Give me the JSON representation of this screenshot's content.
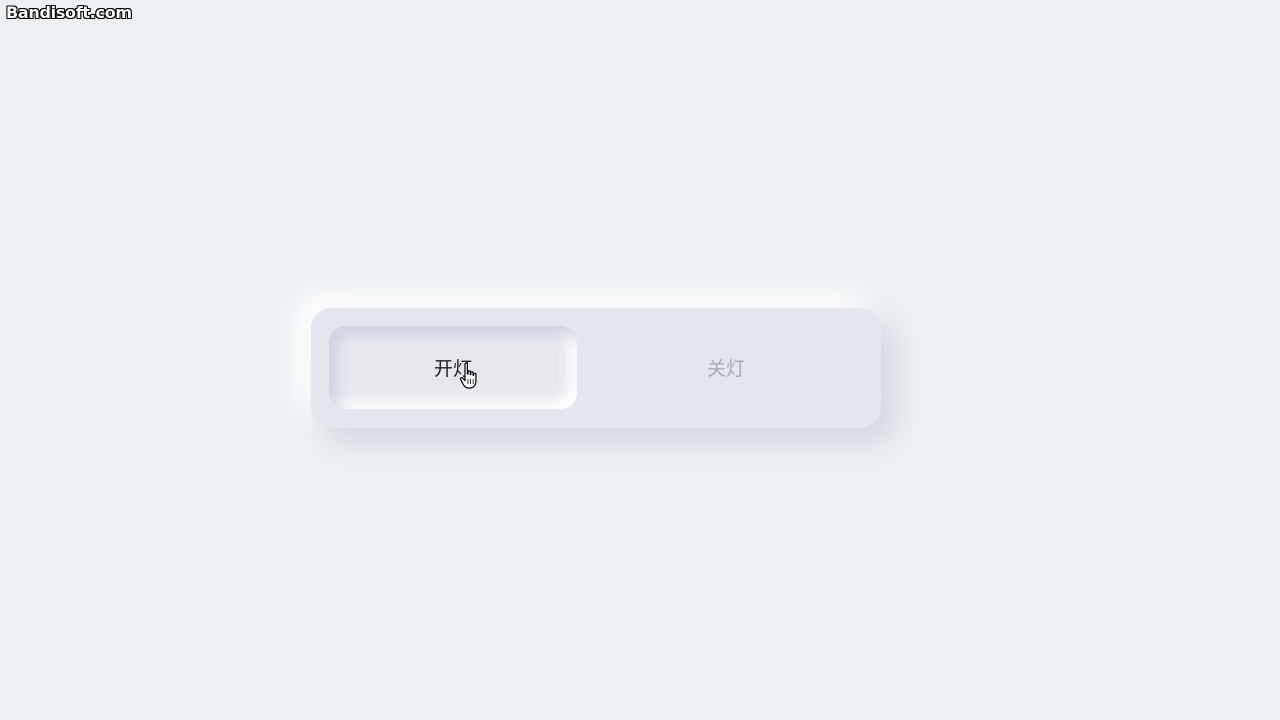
{
  "watermark": "Bandisoft.com",
  "toggle": {
    "options": [
      {
        "label": "开灯",
        "state": "pressed"
      },
      {
        "label": "关灯",
        "state": "idle"
      }
    ],
    "selected": "开灯"
  },
  "cursor": {
    "icon": "hand-pointer-icon"
  },
  "colors": {
    "background": "#ecf0f3",
    "panel": "#e3e6ec",
    "active_text": "#222222",
    "inactive_text": "#a9abb3"
  }
}
